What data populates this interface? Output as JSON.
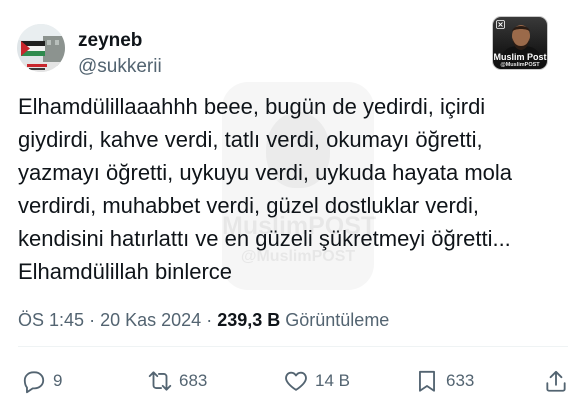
{
  "tweet": {
    "author": {
      "display_name": "zeyneb",
      "handle": "@sukkerii"
    },
    "text_lines": [
      "Elhamdülillaaahhh beee, bugün de yedirdi, içirdi",
      "giydirdi, kahve verdi, tatlı verdi, okumayı öğretti,",
      "yazmayı öğretti, uykuyu verdi, uykuda hayata mola",
      "verdirdi, muhabbet verdi, güzel dostluklar verdi,",
      "kendisini hatırlattı ve en güzeli şükretmeyi öğretti...",
      "Elhamdülillah binlerce"
    ],
    "time": "ÖS 1:45",
    "separator": "·",
    "date": "20 Kas 2024",
    "views_count": "239,3 B",
    "views_label": "Görüntüleme"
  },
  "actions": {
    "reply": {
      "icon": "reply-icon",
      "count": "9"
    },
    "retweet": {
      "icon": "retweet-icon",
      "count": "683"
    },
    "like": {
      "icon": "heart-icon",
      "count": "14 B"
    },
    "bookmark": {
      "icon": "bookmark-icon",
      "count": "633"
    },
    "share": {
      "icon": "share-icon"
    }
  },
  "badge": {
    "title": "Muslim Post",
    "handle": "@MuslimPOST"
  },
  "watermark": {
    "title": "MuslimPOST",
    "handle": "@MuslimPOST"
  },
  "colors": {
    "text": "#0f1419",
    "secondary": "#536471",
    "divider": "#eff3f4",
    "background": "#ffffff"
  }
}
